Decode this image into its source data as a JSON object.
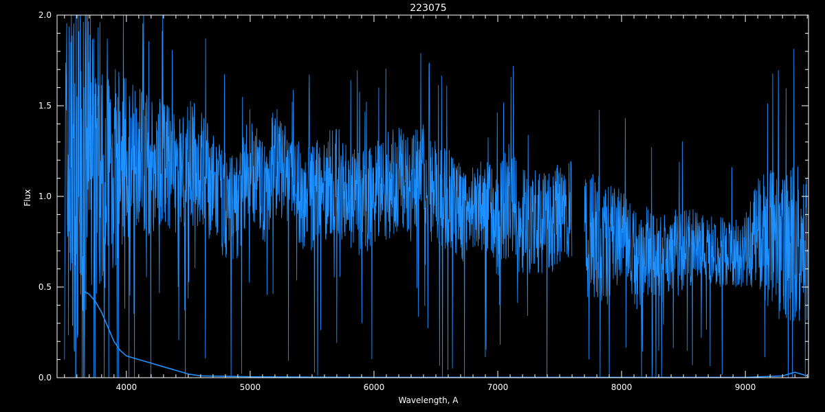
{
  "chart_data": {
    "type": "line",
    "title": "223075",
    "xlabel": "Wavelength, A",
    "ylabel": "Flux",
    "xlim": [
      3440,
      9510
    ],
    "ylim": [
      0.0,
      2.0
    ],
    "xticks": [
      4000,
      5000,
      6000,
      7000,
      8000,
      9000
    ],
    "xtick_labels": [
      "4000",
      "5000",
      "6000",
      "7000",
      "8000",
      "9000"
    ],
    "yticks": [
      0.0,
      0.5,
      1.0,
      1.5,
      2.0
    ],
    "ytick_labels": [
      "0.0",
      "0.5",
      "1.0",
      "1.5",
      "2.0"
    ],
    "grid": false,
    "background": "#000000",
    "axis_color": "#ffffff",
    "series": [
      {
        "color": "#1e90ff",
        "style": "noisy-spectrum",
        "gap": [
          7600,
          7700
        ],
        "x": [
          3500,
          3600,
          3700,
          3800,
          3900,
          4000,
          4100,
          4200,
          4300,
          4400,
          4500,
          4600,
          4700,
          4800,
          4900,
          5000,
          5100,
          5200,
          5300,
          5400,
          5500,
          5600,
          5700,
          5800,
          5900,
          6000,
          6100,
          6200,
          6300,
          6400,
          6500,
          6600,
          6700,
          6800,
          6900,
          7000,
          7100,
          7200,
          7300,
          7400,
          7500,
          7600,
          7700,
          7800,
          7900,
          8000,
          8100,
          8200,
          8300,
          8400,
          8500,
          8600,
          8700,
          8800,
          8900,
          9000,
          9100,
          9200,
          9300,
          9400,
          9500
        ],
        "y": [
          1.1,
          1.15,
          1.2,
          1.25,
          1.15,
          1.2,
          1.25,
          1.15,
          1.2,
          1.1,
          1.2,
          1.15,
          1.05,
          0.95,
          0.95,
          1.2,
          1.0,
          1.2,
          1.1,
          1.0,
          1.0,
          1.05,
          1.1,
          1.0,
          0.95,
          1.05,
          1.05,
          1.1,
          1.05,
          1.1,
          1.0,
          1.0,
          0.9,
          0.95,
          0.95,
          0.85,
          1.0,
          0.85,
          0.85,
          0.85,
          0.9,
          0.9,
          0.75,
          0.8,
          0.7,
          0.8,
          0.65,
          0.7,
          0.65,
          0.7,
          0.7,
          0.75,
          0.7,
          0.7,
          0.7,
          0.7,
          0.8,
          0.75,
          0.7,
          0.75,
          0.7
        ],
        "noise": [
          1.0,
          1.0,
          0.9,
          0.8,
          0.6,
          0.45,
          0.4,
          0.4,
          0.35,
          0.35,
          0.35,
          0.35,
          0.3,
          0.3,
          0.3,
          0.3,
          0.3,
          0.3,
          0.3,
          0.3,
          0.3,
          0.3,
          0.3,
          0.3,
          0.3,
          0.3,
          0.3,
          0.3,
          0.3,
          0.3,
          0.3,
          0.3,
          0.28,
          0.25,
          0.25,
          0.3,
          0.35,
          0.3,
          0.3,
          0.3,
          0.3,
          0.3,
          0.35,
          0.35,
          0.35,
          0.3,
          0.3,
          0.25,
          0.25,
          0.25,
          0.25,
          0.2,
          0.2,
          0.2,
          0.2,
          0.2,
          0.3,
          0.4,
          0.4,
          0.45,
          0.4
        ]
      },
      {
        "color": "#1e90ff",
        "style": "line",
        "x": [
          3650,
          3700,
          3750,
          3800,
          3850,
          3900,
          3950,
          4000,
          4100,
          4200,
          4300,
          4400,
          4500,
          4600,
          4800,
          5000,
          5500,
          6000,
          7000,
          8000,
          9000,
          9300,
          9400,
          9500
        ],
        "y": [
          0.48,
          0.46,
          0.42,
          0.36,
          0.28,
          0.2,
          0.15,
          0.12,
          0.1,
          0.08,
          0.06,
          0.04,
          0.02,
          0.01,
          0.008,
          0.005,
          0.003,
          0.002,
          0.002,
          0.002,
          0.002,
          0.01,
          0.03,
          0.01
        ]
      }
    ]
  }
}
